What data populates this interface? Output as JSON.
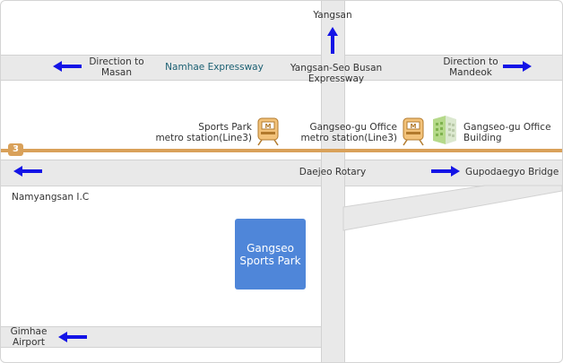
{
  "labels": {
    "yangsan": "Yangsan",
    "direction_masan": [
      "Direction to",
      "Masan"
    ],
    "namhae_expressway": "Namhae Expressway",
    "yangsan_seo_busan": [
      "Yangsan-Seo Busan",
      "Expressway"
    ],
    "direction_mandeok": [
      "Direction to",
      "Mandeok"
    ],
    "sports_park_station": [
      "Sports Park",
      "metro station(Line3)"
    ],
    "gangseo_office_station": [
      "Gangseo-gu Office",
      "metro station(Line3)"
    ],
    "gangseo_office_building": [
      "Gangseo-gu Office",
      "Building"
    ],
    "line_number": "3",
    "daejeo_rotary": "Daejeo Rotary",
    "gupodaegyo_bridge": "Gupodaegyo Bridge",
    "namyangsan_ic": "Namyangsan I.C",
    "gangseo_sports_park": [
      "Gangseo",
      "Sports Park"
    ],
    "gimhae_airport": [
      "Gimhae",
      "Airport"
    ]
  },
  "icons": [
    "arrow-up-icon",
    "arrow-left-icon",
    "arrow-right-icon",
    "metro-train-icon",
    "office-building-icon"
  ],
  "colors": {
    "road": "#e9e9e9",
    "road_edge": "#d2d2d2",
    "arrow": "#1414e6",
    "metro_line3": "#d9a15a",
    "park": "#4f86d9",
    "expressway_label": "#1a5f72",
    "text": "#333333"
  }
}
